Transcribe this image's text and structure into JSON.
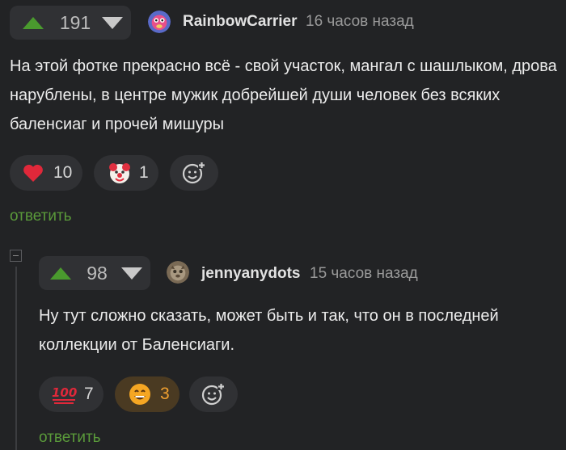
{
  "comment1": {
    "votes": "191",
    "username": "RainbowCarrier",
    "time": "16 часов назад",
    "text": "На этой фотке прекрасно всё - свой участок, мангал с шашлыком, дрова нарублены, в центре мужик добрейшей души человек без всяких баленсиаг и прочей мишуры",
    "reactions": [
      {
        "icon": "heart-icon",
        "count": "10"
      },
      {
        "icon": "clown-icon",
        "count": "1"
      }
    ],
    "reply_label": "ответить"
  },
  "comment2": {
    "votes": "98",
    "username": "jennyanydots",
    "time": "15 часов назад",
    "text": "Ну тут сложно сказать, может быть и так, что он в последней коллекции от Баленсиаги.",
    "reactions": [
      {
        "icon": "hundred-icon",
        "count": "7"
      },
      {
        "icon": "grinning-face-icon",
        "count": "3"
      }
    ],
    "reply_label": "ответить"
  },
  "colors": {
    "background": "#222325",
    "upvote": "#4a9a2e",
    "reply_link": "#5a9a3a",
    "active_reaction": "#f0a030"
  }
}
